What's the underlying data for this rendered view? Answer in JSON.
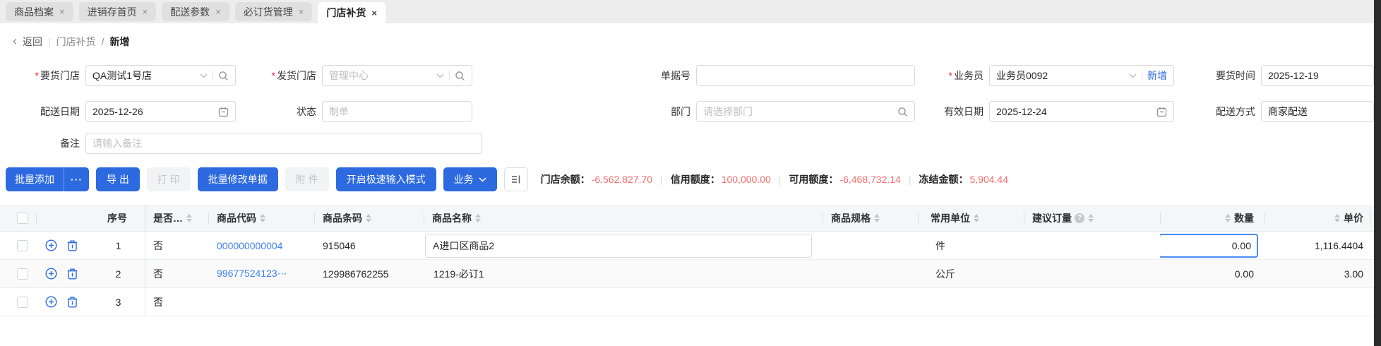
{
  "colors": {
    "accent": "#2d6ae0",
    "link": "#4080f0",
    "danger": "#f56c6c",
    "required": "#f5222d"
  },
  "tabs": {
    "close": "×",
    "items": [
      {
        "label": "商品档案"
      },
      {
        "label": "进销存首页"
      },
      {
        "label": "配送参数"
      },
      {
        "label": "必订货管理"
      },
      {
        "label": "门店补货"
      }
    ]
  },
  "breadcrumb": {
    "back_icon": "‹",
    "back": "返回",
    "divider": "|",
    "section": "门店补货",
    "separator": "/",
    "current": "新增"
  },
  "form": {
    "required_mark": "*",
    "row1": {
      "dest_store": {
        "label": "要货门店",
        "value": "QA测试1号店"
      },
      "src_store": {
        "label": "发货门店",
        "placeholder": "管理中心"
      },
      "doc_no": {
        "label": "单据号",
        "value": ""
      },
      "salesman": {
        "label": "业务员",
        "value": "业务员0092",
        "action": "新增"
      },
      "request_time": {
        "label": "要货时间",
        "value": "2025-12-19"
      }
    },
    "row2": {
      "delivery_date": {
        "label": "配送日期",
        "value": "2025-12-26"
      },
      "status": {
        "label": "状态",
        "value": "制单"
      },
      "department": {
        "label": "部门",
        "placeholder": "请选择部门"
      },
      "valid_date": {
        "label": "有效日期",
        "value": "2025-12-24"
      },
      "delivery_method": {
        "label": "配送方式",
        "value": "商家配送"
      }
    },
    "row3": {
      "remark": {
        "label": "备注",
        "placeholder": "请输入备注"
      }
    }
  },
  "toolbar": {
    "batch_add": "批量添加",
    "more": "···",
    "export": "导 出",
    "print": "打 印",
    "batch_edit": "批量修改单据",
    "attachment": "附 件",
    "speed_mode": "开启极速输入模式",
    "business": "业务",
    "balance": {
      "divider": "|",
      "items": [
        {
          "label": "门店余额：",
          "value": "-6,562,827.70"
        },
        {
          "label": "信用额度：",
          "value": "100,000.00"
        },
        {
          "label": "可用额度：",
          "value": "-6,468,732.14"
        },
        {
          "label": "冻结金额：",
          "value": "5,904.44"
        }
      ]
    }
  },
  "table": {
    "help": "?",
    "headers": {
      "seq": "序号",
      "flag": "是否…",
      "code": "商品代码",
      "barcode": "商品条码",
      "name": "商品名称",
      "spec": "商品规格",
      "unit": "常用单位",
      "suggest": "建议订量",
      "qty": "数量",
      "price": "单价"
    },
    "rows": [
      {
        "seq": "1",
        "flag": "否",
        "code": "000000000004",
        "barcode": "915046",
        "name": "A进口区商品2",
        "spec": "",
        "unit": "件",
        "suggest": "",
        "qty": "0.00",
        "price": "1,116.4404"
      },
      {
        "seq": "2",
        "flag": "否",
        "code": "99677524123⋯",
        "barcode": "129986762255",
        "name": "1219-必订1",
        "spec": "",
        "unit": "公斤",
        "suggest": "",
        "qty": "0.00",
        "price": "3.00"
      },
      {
        "seq": "3",
        "flag": "否",
        "code": "",
        "barcode": "",
        "name": "",
        "spec": "",
        "unit": "",
        "suggest": "",
        "qty": "",
        "price": ""
      }
    ]
  }
}
